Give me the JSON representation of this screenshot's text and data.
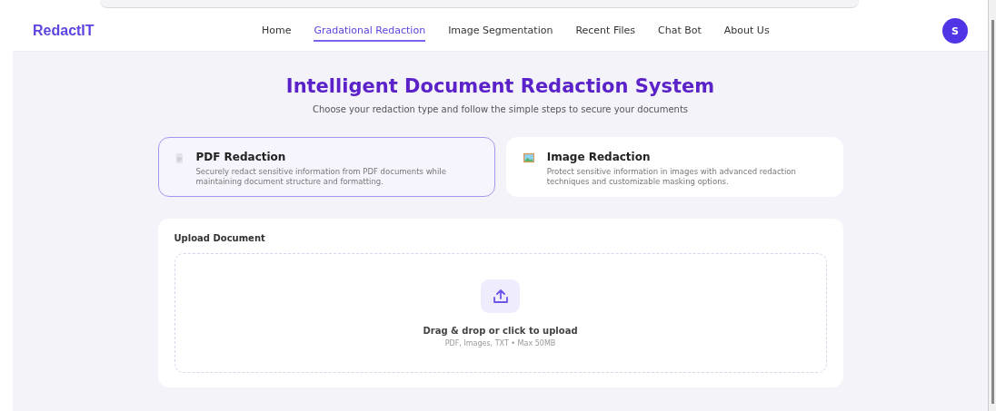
{
  "nav": {
    "logo": "RedactIT",
    "links": [
      {
        "label": "Home",
        "selected": false
      },
      {
        "label": "Gradational Redaction",
        "selected": true
      },
      {
        "label": "Image Segmentation",
        "selected": false
      },
      {
        "label": "Recent Files",
        "selected": false
      },
      {
        "label": "Chat Bot",
        "selected": false
      },
      {
        "label": "About Us",
        "selected": false
      }
    ],
    "avatar": "S"
  },
  "heading": "Intelligent Document Redaction System",
  "subheading": "Choose your redaction type and follow the simple steps to secure your documents",
  "options": [
    {
      "kind": "pdf",
      "title": "PDF Redaction",
      "description": "Securely redact sensitive information from PDF documents while maintaining document structure and formatting.",
      "selected": true
    },
    {
      "kind": "image",
      "title": "Image Redaction",
      "description": "Protect sensitive information in images with advanced redaction techniques and customizable masking options.",
      "selected": false
    }
  ],
  "upload": {
    "title": "Upload Document",
    "prompt": "Drag & drop or click to upload",
    "hint": "PDF, Images, TXT • Max 50MB"
  }
}
